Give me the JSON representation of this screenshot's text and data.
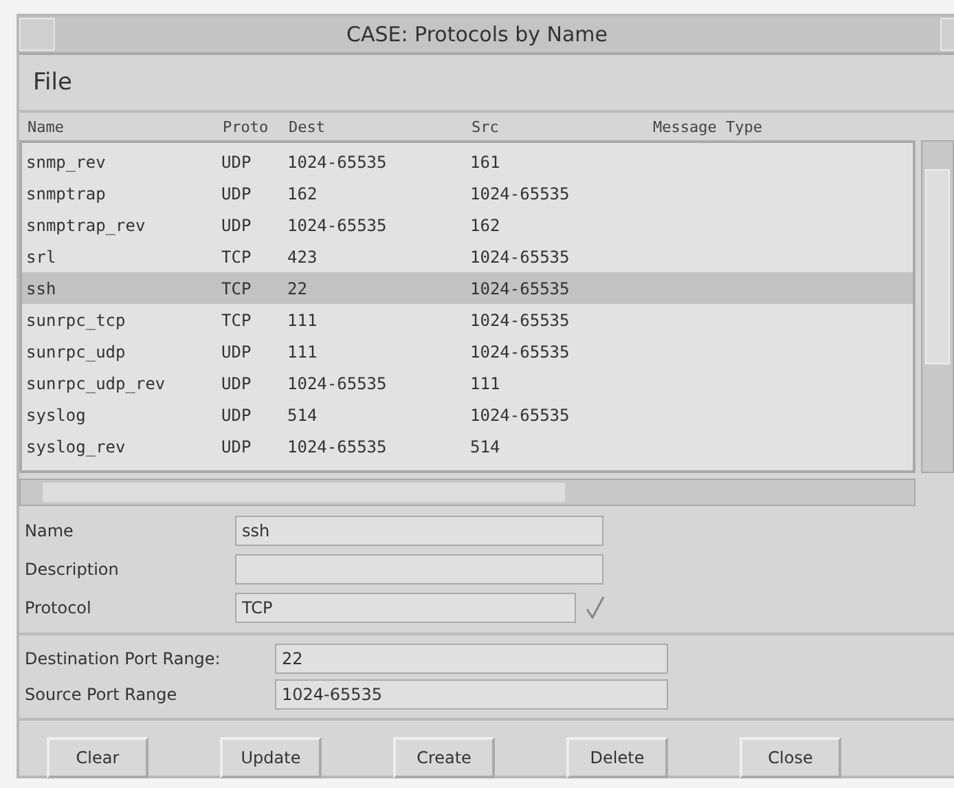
{
  "window": {
    "title": "CASE: Protocols by Name"
  },
  "menu": [
    "File"
  ],
  "table": {
    "columns": [
      "Name",
      "Proto",
      "Dest",
      "Src",
      "Message Type"
    ],
    "rows": [
      {
        "cells": [
          "snmp_rev",
          "UDP",
          "1024-65535",
          "161"
        ],
        "selected": false
      },
      {
        "cells": [
          "snmptrap",
          "UDP",
          "162",
          "1024-65535"
        ],
        "selected": false
      },
      {
        "cells": [
          "snmptrap_rev",
          "UDP",
          "1024-65535",
          "162"
        ],
        "selected": false
      },
      {
        "cells": [
          "srl",
          "TCP",
          "423",
          "1024-65535"
        ],
        "selected": false
      },
      {
        "cells": [
          "ssh",
          "TCP",
          "22",
          "1024-65535"
        ],
        "selected": true
      },
      {
        "cells": [
          "sunrpc_tcp",
          "TCP",
          "111",
          "1024-65535"
        ],
        "selected": false
      },
      {
        "cells": [
          "sunrpc_udp",
          "UDP",
          "111",
          "1024-65535"
        ],
        "selected": false
      },
      {
        "cells": [
          "sunrpc_udp_rev",
          "UDP",
          "1024-65535",
          "111"
        ],
        "selected": false
      },
      {
        "cells": [
          "syslog",
          "UDP",
          "514",
          "1024-65535"
        ],
        "selected": false
      },
      {
        "cells": [
          "syslog_rev",
          "UDP",
          "1024-65535",
          "514"
        ],
        "selected": false
      }
    ]
  },
  "form": [
    {
      "label": "Name",
      "value": "ssh",
      "kind": "text"
    },
    {
      "label": "Description",
      "kind": "text"
    },
    {
      "label": "Protocol",
      "value": "TCP",
      "kind": "option"
    }
  ],
  "ports": [
    {
      "label": "Destination Port Range:",
      "value": "22"
    },
    {
      "label": "Source Port Range",
      "value": "1024-65535"
    }
  ],
  "buttons": [
    "Clear",
    "Update",
    "Create",
    "Delete",
    "Close"
  ]
}
